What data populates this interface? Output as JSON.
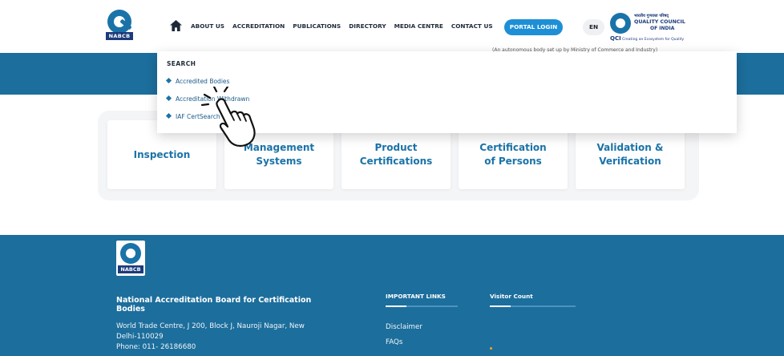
{
  "header": {
    "logo_tag": "NABCB",
    "nav": [
      "ABOUT US",
      "ACCREDITATION",
      "PUBLICATIONS",
      "DIRECTORY",
      "MEDIA CENTRE",
      "CONTACT US"
    ],
    "active_nav": "DIRECTORY",
    "portal_login": "PORTAL LOGIN",
    "language": "EN",
    "qci": {
      "line1": "भारतीय गुणवत्ता परिषद्",
      "line2": "QUALITY COUNCIL",
      "line3": "OF INDIA",
      "abbr": "QCI",
      "tagline": "Creating an Ecosystem for Quality"
    },
    "banner_note": "(An autonomous body set up by Ministry of Commerce and Industry)"
  },
  "dropdown": {
    "title": "SEARCH",
    "items": [
      "Accredited Bodies",
      "Accreditation Withdrawn",
      "IAF CertSearch"
    ]
  },
  "cards": [
    {
      "label": "Inspection"
    },
    {
      "label": "Management Systems"
    },
    {
      "label": "Product Certifications"
    },
    {
      "label": "Certification of Persons"
    },
    {
      "label": "Validation & Verification"
    }
  ],
  "footer": {
    "logo_tag": "NABCB",
    "org_name": "National Accreditation Board for Certification Bodies",
    "address_line1": "World Trade Centre, J 200, Block J, Nauroji Nagar, New",
    "address_line2": "Delhi-110029",
    "phone": "Phone:  011- 26186680",
    "important_links_title": "IMPORTANT LINKS",
    "visitor_count_title": "Visitor Count",
    "links": [
      "Disclaimer",
      "FAQs"
    ]
  },
  "colors": {
    "primary_blue": "#1c6e9c",
    "accent_blue": "#1d8fd6",
    "card_text": "#1a73a8"
  }
}
